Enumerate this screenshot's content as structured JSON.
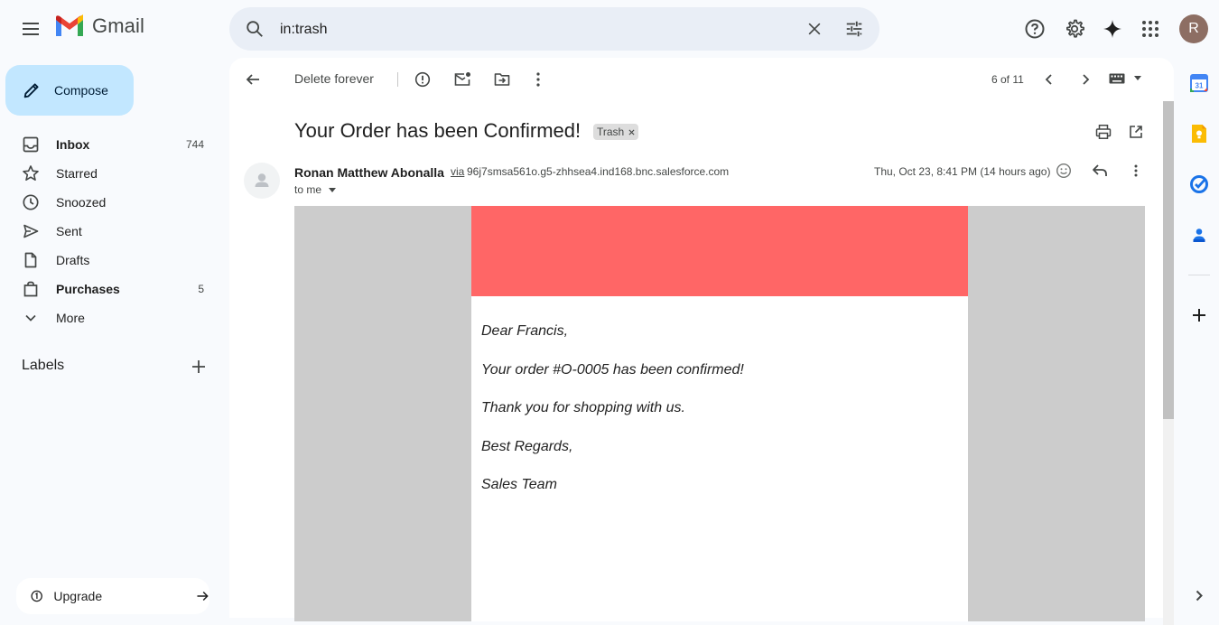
{
  "app": {
    "name": "Gmail"
  },
  "search": {
    "value": "in:trash"
  },
  "compose": {
    "label": "Compose"
  },
  "nav": {
    "items": [
      {
        "label": "Inbox",
        "count": "744"
      },
      {
        "label": "Starred",
        "count": ""
      },
      {
        "label": "Snoozed",
        "count": ""
      },
      {
        "label": "Sent",
        "count": ""
      },
      {
        "label": "Drafts",
        "count": ""
      },
      {
        "label": "Purchases",
        "count": "5"
      },
      {
        "label": "More",
        "count": ""
      }
    ],
    "labels_header": "Labels",
    "upgrade_label": "Upgrade"
  },
  "toolbar": {
    "delete_forever": "Delete forever",
    "pager": "6 of 11"
  },
  "message": {
    "subject": "Your Order has been Confirmed!",
    "label_chip": "Trash",
    "sender_name": "Ronan Matthew Abonalla",
    "via": "via",
    "via_address": "96j7smsa561o.g5-zhhsea4.ind168.bnc.salesforce.com",
    "to": "to me",
    "date": "Thu, Oct 23, 8:41 PM (14 hours ago)",
    "body_lines": [
      "Dear Francis,",
      "Your order #O-0005 has been confirmed!",
      "Thank you for shopping with us.",
      "Best Regards,",
      "Sales Team"
    ]
  },
  "account": {
    "initial": "R"
  },
  "colors": {
    "compose_bg": "#c2e7ff",
    "search_bg": "#e9eef6",
    "email_banner": "#ff6666",
    "email_backdrop": "#cccccc",
    "avatar": "#8d6e63"
  }
}
